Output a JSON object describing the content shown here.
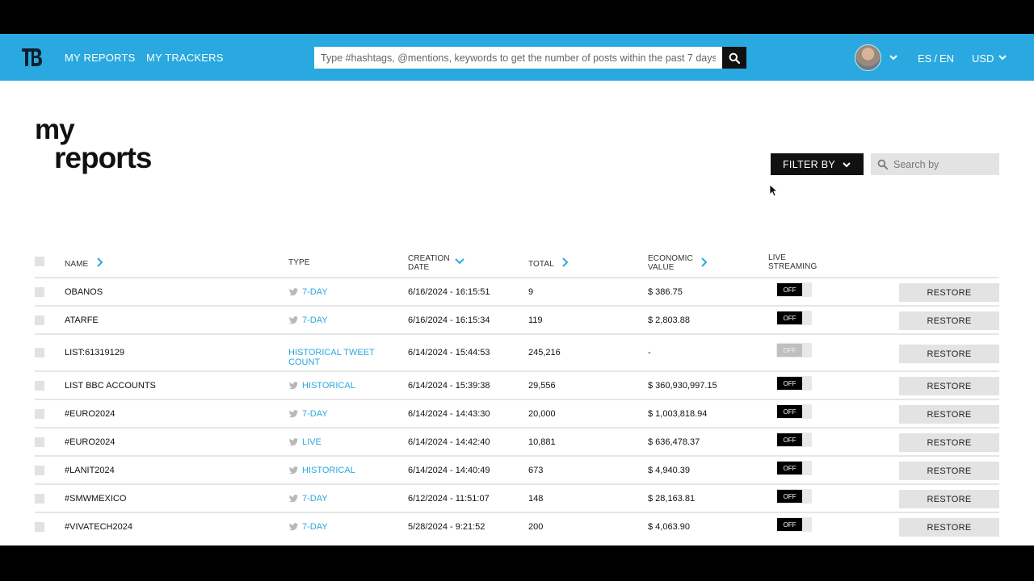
{
  "nav": {
    "my_reports": "MY REPORTS",
    "my_trackers": "MY TRACKERS"
  },
  "search": {
    "placeholder": "Type #hashtags, @mentions, keywords to get the number of posts within the past 7 days"
  },
  "header": {
    "lang_es": "ES",
    "lang_sep": "/",
    "lang_en": "EN",
    "currency": "USD"
  },
  "title": {
    "line1": "my",
    "line2": "reports"
  },
  "toolbar": {
    "filter_label": "FILTER BY",
    "searchby_placeholder": "Search by"
  },
  "table": {
    "headers": {
      "name": "NAME",
      "type": "TYPE",
      "creation_date_l1": "CREATION",
      "creation_date_l2": "DATE",
      "total": "TOTAL",
      "economic_value_l1": "ECONOMIC",
      "economic_value_l2": "VALUE",
      "live_streaming_l1": "LIVE",
      "live_streaming_l2": "STREAMING"
    },
    "toggle_off": "OFF",
    "restore_label": "RESTORE",
    "rows": [
      {
        "name": "OBANOS",
        "type": "7-DAY",
        "date": "6/16/2024 - 16:15:51",
        "total": "9",
        "value": "$ 386.75"
      },
      {
        "name": "ATARFE",
        "type": "7-DAY",
        "date": "6/16/2024 - 16:15:34",
        "total": "119",
        "value": "$ 2,803.88"
      },
      {
        "name": "LIST:61319129",
        "type_l1": "HISTORICAL TWEET",
        "type_l2": "COUNT",
        "date": "6/14/2024 - 15:44:53",
        "total": "245,216",
        "value": "-"
      },
      {
        "name": "LIST BBC ACCOUNTS",
        "type": "HISTORICAL",
        "date": "6/14/2024 - 15:39:38",
        "total": "29,556",
        "value": "$ 360,930,997.15"
      },
      {
        "name": "#EURO2024",
        "type": "7-DAY",
        "date": "6/14/2024 - 14:43:30",
        "total": "20,000",
        "value": "$ 1,003,818.94"
      },
      {
        "name": "#EURO2024",
        "type": "LIVE",
        "date": "6/14/2024 - 14:42:40",
        "total": "10,881",
        "value": "$ 636,478.37"
      },
      {
        "name": "#LANIT2024",
        "type": "HISTORICAL",
        "date": "6/14/2024 - 14:40:49",
        "total": "673",
        "value": "$ 4,940.39"
      },
      {
        "name": "#SMWMEXICO",
        "type": "7-DAY",
        "date": "6/12/2024 - 11:51:07",
        "total": "148",
        "value": "$ 28,163.81"
      },
      {
        "name": "#VIVATECH2024",
        "type": "7-DAY",
        "date": "5/28/2024 - 9:21:52",
        "total": "200",
        "value": "$ 4,063.90"
      }
    ]
  },
  "colors": {
    "header_bg": "#29a9e0",
    "link": "#29a9e0",
    "dark": "#111111"
  }
}
